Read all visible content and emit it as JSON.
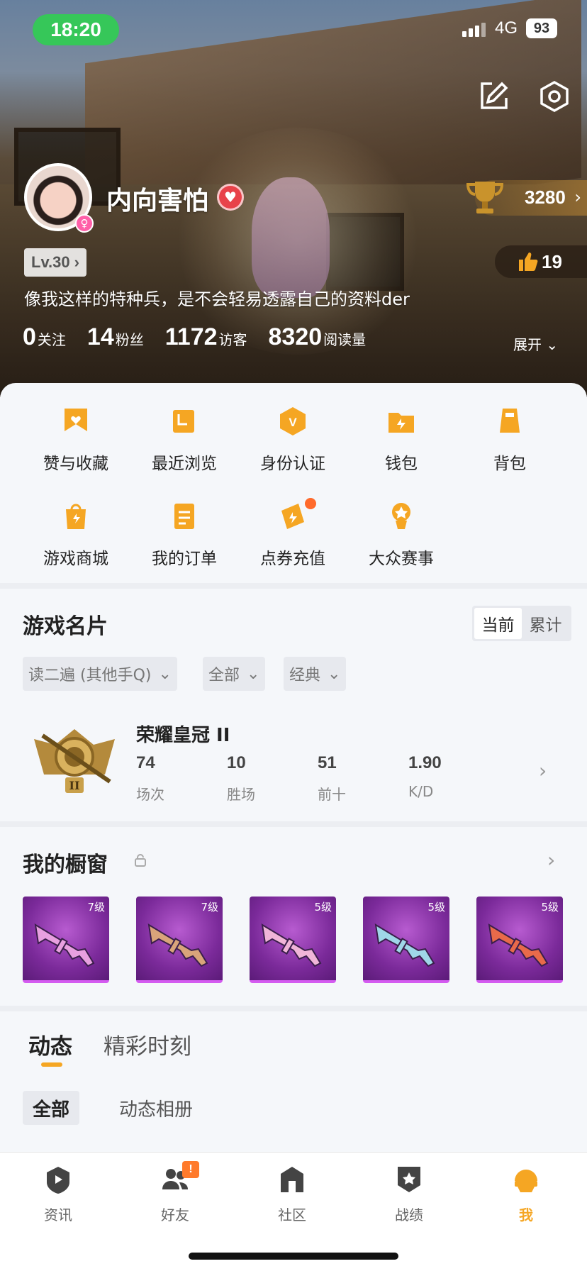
{
  "status": {
    "time": "18:20",
    "network": "4G",
    "battery": "93"
  },
  "profile": {
    "username": "内向害怕",
    "level": "Lv.30",
    "bio": "像我这样的特种兵，是不会轻易透露自己的资料der",
    "trophy": "3280",
    "likes": "19",
    "stats": [
      {
        "value": "0",
        "label": "关注"
      },
      {
        "value": "14",
        "label": "粉丝"
      },
      {
        "value": "1172",
        "label": "访客"
      },
      {
        "value": "8320",
        "label": "阅读量"
      }
    ],
    "expand_label": "展开"
  },
  "menu": [
    {
      "label": "赞与收藏",
      "icon": "bookmark-heart-icon"
    },
    {
      "label": "最近浏览",
      "icon": "recent-icon"
    },
    {
      "label": "身份认证",
      "icon": "verify-icon"
    },
    {
      "label": "钱包",
      "icon": "wallet-icon"
    },
    {
      "label": "背包",
      "icon": "backpack-icon"
    },
    {
      "label": "游戏商城",
      "icon": "shop-bag-icon"
    },
    {
      "label": "我的订单",
      "icon": "order-icon"
    },
    {
      "label": "点券充值",
      "icon": "coupon-icon"
    },
    {
      "label": "大众赛事",
      "icon": "tournament-icon"
    }
  ],
  "game_card": {
    "title": "游戏名片",
    "toggle": [
      "当前",
      "累计"
    ],
    "filters": [
      "读二遍 (其他手Q)",
      "全部",
      "经典"
    ],
    "rank_name": "荣耀皇冠 II",
    "stats": [
      {
        "value": "74",
        "label": "场次"
      },
      {
        "value": "10",
        "label": "胜场"
      },
      {
        "value": "51",
        "label": "前十"
      },
      {
        "value": "1.90",
        "label": "K/D"
      }
    ]
  },
  "showcase": {
    "title": "我的橱窗",
    "items": [
      {
        "level": "7级",
        "color": "#e8a0e0"
      },
      {
        "level": "7级",
        "color": "#d9a47a"
      },
      {
        "level": "5级",
        "color": "#f0b5d8"
      },
      {
        "level": "5级",
        "color": "#9fd6e8"
      },
      {
        "level": "5级",
        "color": "#e86a4a"
      }
    ]
  },
  "feed_tabs": {
    "tabs": [
      "动态",
      "精彩时刻"
    ],
    "subtabs": [
      "全部",
      "动态相册"
    ]
  },
  "nav": [
    {
      "label": "资讯",
      "icon": "news-icon"
    },
    {
      "label": "好友",
      "icon": "friends-icon",
      "badge": "!"
    },
    {
      "label": "社区",
      "icon": "community-icon"
    },
    {
      "label": "战绩",
      "icon": "record-icon"
    },
    {
      "label": "我",
      "icon": "me-icon"
    }
  ],
  "colors": {
    "accent": "#f5a623",
    "status_green": "#36c759"
  }
}
